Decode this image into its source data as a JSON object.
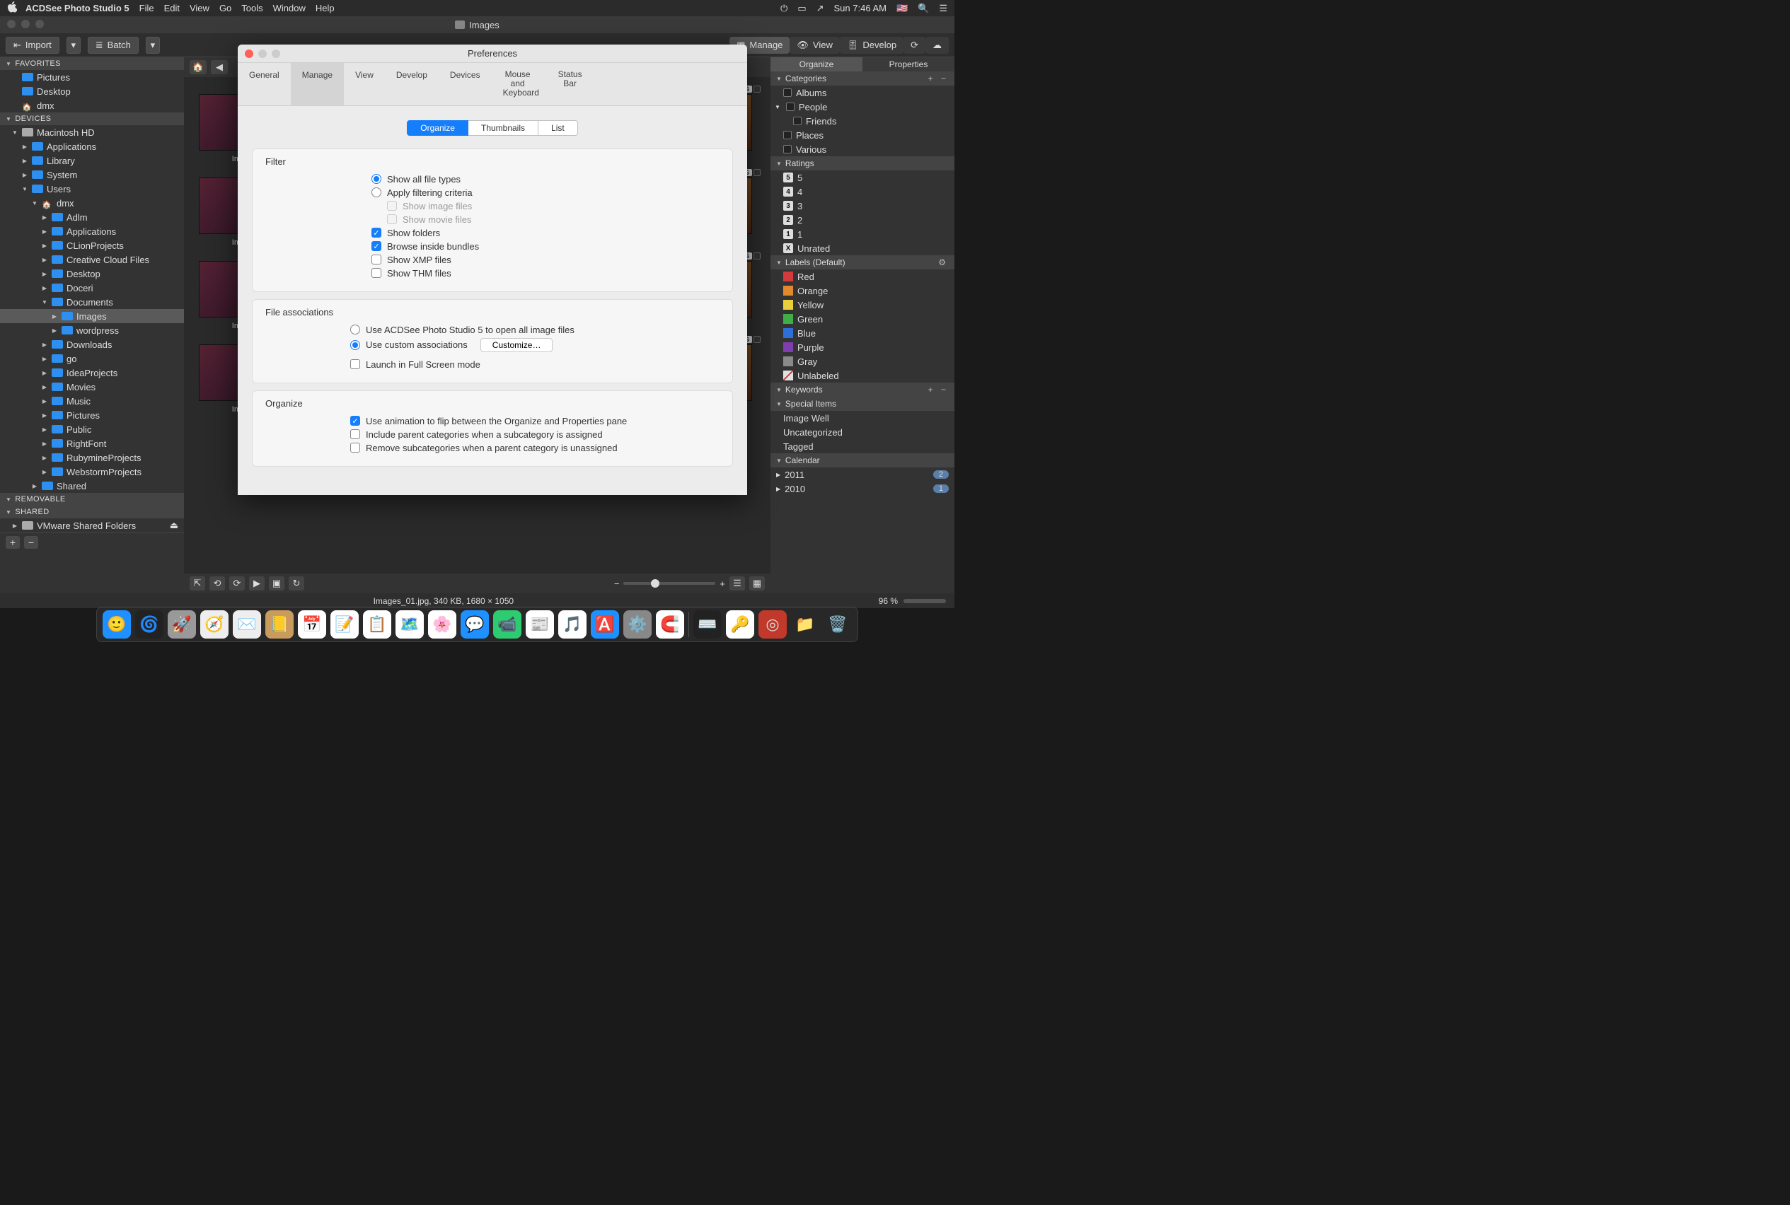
{
  "menubar": {
    "app": "ACDSee Photo Studio 5",
    "items": [
      "File",
      "Edit",
      "View",
      "Go",
      "Tools",
      "Window",
      "Help"
    ],
    "clock": "Sun 7:46 AM"
  },
  "window": {
    "title": "Images"
  },
  "toolbar": {
    "import": "Import",
    "batch": "Batch",
    "modes": {
      "manage": "Manage",
      "view": "View",
      "develop": "Develop"
    }
  },
  "left": {
    "sections": {
      "favorites": {
        "title": "FAVORITES",
        "items": [
          {
            "label": "Pictures",
            "icon": "blue"
          },
          {
            "label": "Desktop",
            "icon": "blue"
          },
          {
            "label": "dmx",
            "icon": "house"
          }
        ]
      },
      "devices": {
        "title": "DEVICES",
        "tree": [
          {
            "label": "Macintosh HD",
            "icon": "drive",
            "depth": 0,
            "exp": "▼",
            "children": [
              {
                "label": "Applications",
                "icon": "blue",
                "depth": 1,
                "exp": "▶"
              },
              {
                "label": "Library",
                "icon": "blue",
                "depth": 1,
                "exp": "▶"
              },
              {
                "label": "System",
                "icon": "blue",
                "depth": 1,
                "exp": "▶"
              },
              {
                "label": "Users",
                "icon": "blue",
                "depth": 1,
                "exp": "▼",
                "children": [
                  {
                    "label": "dmx",
                    "icon": "house",
                    "depth": 2,
                    "exp": "▼",
                    "children": [
                      {
                        "label": "Adlm",
                        "icon": "blue",
                        "depth": 3,
                        "exp": "▶"
                      },
                      {
                        "label": "Applications",
                        "icon": "blue",
                        "depth": 3,
                        "exp": "▶"
                      },
                      {
                        "label": "CLionProjects",
                        "icon": "blue",
                        "depth": 3,
                        "exp": "▶"
                      },
                      {
                        "label": "Creative Cloud Files",
                        "icon": "blue",
                        "depth": 3,
                        "exp": "▶"
                      },
                      {
                        "label": "Desktop",
                        "icon": "blue",
                        "depth": 3,
                        "exp": "▶"
                      },
                      {
                        "label": "Doceri",
                        "icon": "blue",
                        "depth": 3,
                        "exp": "▶"
                      },
                      {
                        "label": "Documents",
                        "icon": "blue",
                        "depth": 3,
                        "exp": "▼",
                        "children": [
                          {
                            "label": "Images",
                            "icon": "blue",
                            "depth": 4,
                            "exp": "▶",
                            "selected": true
                          },
                          {
                            "label": "wordpress",
                            "icon": "blue",
                            "depth": 4,
                            "exp": "▶"
                          }
                        ]
                      },
                      {
                        "label": "Downloads",
                        "icon": "blue",
                        "depth": 3,
                        "exp": "▶"
                      },
                      {
                        "label": "go",
                        "icon": "blue",
                        "depth": 3,
                        "exp": "▶"
                      },
                      {
                        "label": "IdeaProjects",
                        "icon": "blue",
                        "depth": 3,
                        "exp": "▶"
                      },
                      {
                        "label": "Movies",
                        "icon": "blue",
                        "depth": 3,
                        "exp": "▶"
                      },
                      {
                        "label": "Music",
                        "icon": "blue",
                        "depth": 3,
                        "exp": "▶"
                      },
                      {
                        "label": "Pictures",
                        "icon": "blue",
                        "depth": 3,
                        "exp": "▶"
                      },
                      {
                        "label": "Public",
                        "icon": "blue",
                        "depth": 3,
                        "exp": "▶"
                      },
                      {
                        "label": "RightFont",
                        "icon": "blue",
                        "depth": 3,
                        "exp": "▶"
                      },
                      {
                        "label": "RubymineProjects",
                        "icon": "blue",
                        "depth": 3,
                        "exp": "▶"
                      },
                      {
                        "label": "WebstormProjects",
                        "icon": "blue",
                        "depth": 3,
                        "exp": "▶"
                      }
                    ]
                  }
                ]
              },
              {
                "label": "Shared",
                "icon": "blue",
                "depth": 2,
                "exp": "▶"
              }
            ]
          }
        ]
      },
      "removable": {
        "title": "REMOVABLE"
      },
      "shared": {
        "title": "SHARED",
        "items": [
          {
            "label": "VMware Shared Folders",
            "icon": "drive",
            "exp": "▶",
            "eject": true
          }
        ]
      }
    }
  },
  "thumbs": {
    "caption_prefix": "Imag",
    "badge_jpg": "JPG"
  },
  "right": {
    "tabs": {
      "organize": "Organize",
      "properties": "Properties"
    },
    "categories": {
      "title": "Categories",
      "items": [
        "Albums",
        "People",
        "Friends",
        "Places",
        "Various"
      ]
    },
    "ratings": {
      "title": "Ratings",
      "items": [
        {
          "n": "5",
          "l": "5"
        },
        {
          "n": "4",
          "l": "4"
        },
        {
          "n": "3",
          "l": "3"
        },
        {
          "n": "2",
          "l": "2"
        },
        {
          "n": "1",
          "l": "1"
        },
        {
          "n": "X",
          "l": "Unrated"
        }
      ]
    },
    "labels": {
      "title": "Labels (Default)",
      "items": [
        {
          "c": "#d23b3b",
          "l": "Red"
        },
        {
          "c": "#e28a2b",
          "l": "Orange"
        },
        {
          "c": "#e9cf3a",
          "l": "Yellow"
        },
        {
          "c": "#3fae49",
          "l": "Green"
        },
        {
          "c": "#2d6fd6",
          "l": "Blue"
        },
        {
          "c": "#7d3fae",
          "l": "Purple"
        },
        {
          "c": "#8a8a8a",
          "l": "Gray"
        },
        {
          "c": "#e0e0e0",
          "l": "Unlabeled",
          "strike": true
        }
      ]
    },
    "keywords": {
      "title": "Keywords"
    },
    "special": {
      "title": "Special Items",
      "items": [
        "Image Well",
        "Uncategorized",
        "Tagged"
      ]
    },
    "calendar": {
      "title": "Calendar",
      "items": [
        {
          "l": "2011",
          "c": "2"
        },
        {
          "l": "2010",
          "c": "1"
        }
      ]
    }
  },
  "status": {
    "info": "Images_01.jpg, 340 KB, 1680 × 1050",
    "pct": "96 %"
  },
  "prefs": {
    "title": "Preferences",
    "tabs": [
      "General",
      "Manage",
      "View",
      "Develop",
      "Devices",
      "Mouse and Keyboard",
      "Status Bar"
    ],
    "active_tab": "Manage",
    "seg": [
      "Organize",
      "Thumbnails",
      "List"
    ],
    "active_seg": "Organize",
    "filter": {
      "title": "Filter",
      "opt_all": "Show all file types",
      "opt_apply": "Apply filtering criteria",
      "sub_image": "Show image files",
      "sub_movie": "Show movie files",
      "folders": "Show folders",
      "bundles": "Browse inside bundles",
      "xmp": "Show XMP files",
      "thm": "Show THM files"
    },
    "assoc": {
      "title": "File associations",
      "opt_acd": "Use ACDSee Photo Studio 5 to open all image files",
      "opt_custom": "Use custom associations",
      "btn": "Customize…",
      "fullscreen": "Launch in Full Screen mode"
    },
    "organize": {
      "title": "Organize",
      "anim": "Use animation to flip between the Organize and Properties pane",
      "incl": "Include parent categories when a subcategory is assigned",
      "remove": "Remove subcategories when a parent category is unassigned"
    }
  },
  "dock": {
    "icons": [
      {
        "name": "finder",
        "c": "#1e90ff",
        "e": "🙂"
      },
      {
        "name": "siri",
        "c": "#222",
        "e": "🌀"
      },
      {
        "name": "launchpad",
        "c": "#999",
        "e": "🚀"
      },
      {
        "name": "safari",
        "c": "#eee",
        "e": "🧭"
      },
      {
        "name": "mail",
        "c": "#eee",
        "e": "✉️"
      },
      {
        "name": "contacts",
        "c": "#c99b5e",
        "e": "📒"
      },
      {
        "name": "calendar",
        "c": "#fff",
        "e": "📅"
      },
      {
        "name": "notes",
        "c": "#fff",
        "e": "📝"
      },
      {
        "name": "reminders",
        "c": "#fff",
        "e": "📋"
      },
      {
        "name": "maps",
        "c": "#fff",
        "e": "🗺️"
      },
      {
        "name": "photos",
        "c": "#fff",
        "e": "🌸"
      },
      {
        "name": "messages",
        "c": "#1e90ff",
        "e": "💬"
      },
      {
        "name": "facetime",
        "c": "#2ecc71",
        "e": "📹"
      },
      {
        "name": "news",
        "c": "#fff",
        "e": "📰"
      },
      {
        "name": "itunes",
        "c": "#fff",
        "e": "🎵"
      },
      {
        "name": "appstore",
        "c": "#1e90ff",
        "e": "🅰️"
      },
      {
        "name": "settings",
        "c": "#888",
        "e": "⚙️"
      },
      {
        "name": "magnet",
        "c": "#fff",
        "e": "🧲"
      }
    ],
    "icons_right": [
      {
        "name": "terminal",
        "c": "#222",
        "e": "⌨️"
      },
      {
        "name": "1password",
        "c": "#fff",
        "e": "🔑"
      },
      {
        "name": "acdsee",
        "c": "#c0392b",
        "e": "◎"
      },
      {
        "name": "downloads",
        "c": "none",
        "e": "📁"
      },
      {
        "name": "trash",
        "c": "none",
        "e": "🗑️"
      }
    ]
  }
}
